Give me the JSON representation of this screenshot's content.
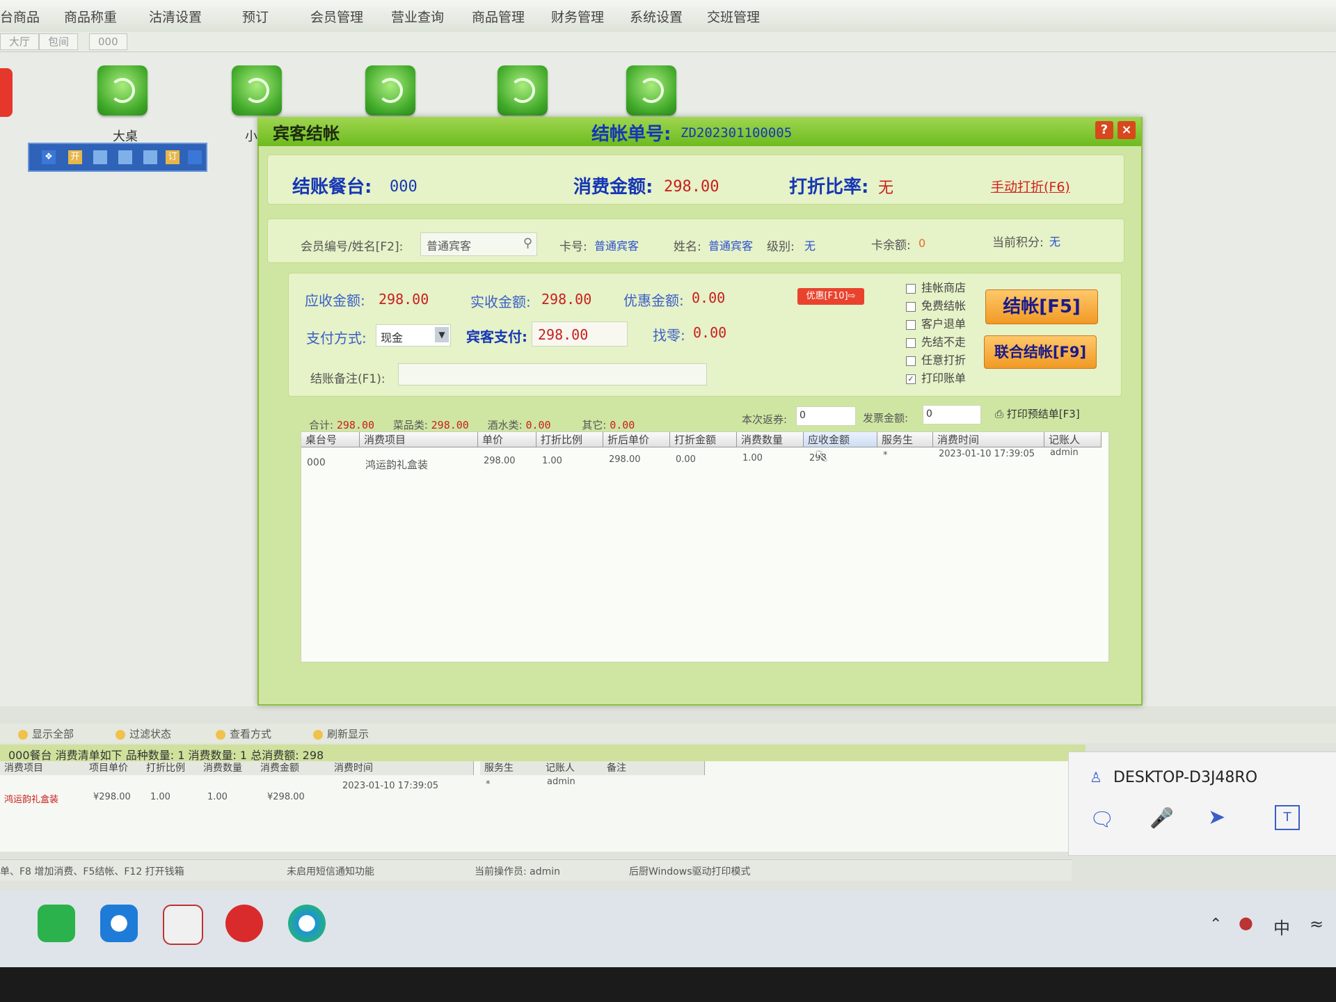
{
  "top_menu": {
    "items": [
      "台商品",
      "商品称重",
      "沽清设置",
      "预订",
      "会员管理",
      "营业查询",
      "商品管理",
      "财务管理",
      "系统设置",
      "交班管理"
    ]
  },
  "area_tabs": [
    "大厅",
    "包间",
    "000"
  ],
  "tables": [
    {
      "label": "大桌"
    },
    {
      "label": "小"
    }
  ],
  "status_buttons": [
    "❖",
    "开",
    "",
    "",
    "",
    "订",
    ""
  ],
  "dialog": {
    "title": "宾客结帐",
    "bill_no_label": "结帐单号:",
    "bill_no": "ZD202301100005",
    "help_icon": "?",
    "close_icon": "×",
    "info": {
      "table_label": "结账餐台:",
      "table_value": "000",
      "amount_label": "消费金额:",
      "amount_value": "298.00",
      "discount_label": "打折比率:",
      "discount_value": "无",
      "manual_discount": "手动打折(F6)"
    },
    "member": {
      "label": "会员编号/姓名[F2]:",
      "input_value": "普通宾客",
      "card_label": "卡号:",
      "card_value": "普通宾客",
      "name_label": "姓名:",
      "name_value": "普通宾客",
      "level_label": "级别:",
      "level_value": "无",
      "balance_label": "卡余额:",
      "balance_value": "0",
      "points_label": "当前积分:",
      "points_value": "无"
    },
    "payment": {
      "receivable_label": "应收金额:",
      "receivable_value": "298.00",
      "actual_label": "实收金额:",
      "actual_value": "298.00",
      "discount_amount_label": "优惠金额:",
      "discount_amount_value": "0.00",
      "coupon_button": "优惠[F10]⇨",
      "method_label": "支付方式:",
      "method_value": "现金",
      "guest_pay_label": "宾客支付:",
      "guest_pay_value": "298.00",
      "change_label": "找零:",
      "change_value": "0.00",
      "remark_label": "结账备注(F1):",
      "remark_value": ""
    },
    "options": [
      {
        "label": "挂帐商店",
        "checked": false
      },
      {
        "label": "免费结帐",
        "checked": false
      },
      {
        "label": "客户退单",
        "checked": false
      },
      {
        "label": "先结不走",
        "checked": false
      },
      {
        "label": "任意打折",
        "checked": false
      },
      {
        "label": "打印账单",
        "checked": true
      }
    ],
    "checkout_button": "结帐[F5]",
    "joint_checkout_button": "联合结帐[F9]",
    "totals": {
      "total_label": "合计:",
      "total_value": "298.00",
      "dishes_label": "菜品类:",
      "dishes_value": "298.00",
      "drinks_label": "酒水类:",
      "drinks_value": "0.00",
      "other_label": "其它:",
      "other_value": "0.00",
      "voucher_label": "本次返券:",
      "voucher_value": "0",
      "invoice_label": "发票金额:",
      "invoice_value": "0",
      "print_prebill": "打印预结单[F3]"
    },
    "grid": {
      "headers": [
        "桌台号",
        "消费项目",
        "单价",
        "打折比例",
        "折后单价",
        "打折金额",
        "消费数量",
        "应收金额",
        "服务生",
        "消费时间",
        "记账人"
      ],
      "rows": [
        [
          "000",
          "鸿运韵礼盒装",
          "298.00",
          "1.00",
          "298.00",
          "0.00",
          "1.00",
          "298",
          "*",
          "2023-01-10 17:39:05",
          "admin"
        ]
      ]
    }
  },
  "bottom_tools": [
    "显示全部",
    "过滤状态",
    "查看方式",
    "刷新显示"
  ],
  "summary_text": "000餐台  消费清单如下  品种数量: 1 消费数量: 1 总消费额: 298",
  "bottom_table": {
    "headers": [
      "消费项目",
      "项目单价",
      "打折比例",
      "消费数量",
      "消费金额",
      "消费时间",
      "服务生",
      "记账人",
      "备注"
    ],
    "row": [
      "鸿运韵礼盒装",
      "¥298.00",
      "1.00",
      "1.00",
      "¥298.00",
      "2023-01-10 17:39:05",
      "*",
      "admin",
      ""
    ]
  },
  "statusbar": {
    "shortcuts": "单、F8 增加消费、F5结帐、F12 打开钱箱",
    "sms": "未启用短信通知功能",
    "operator": "当前操作员: admin",
    "printer": "后厨Windows驱动打印模式"
  },
  "remote_panel": {
    "host": "DESKTOP-D3J48RO"
  },
  "tray": {
    "ime": "中"
  },
  "colors": {
    "title_green": "#6dbb1f",
    "label_blue": "#1536b5",
    "value_red": "#c81e1e",
    "button_orange": "#f09a24"
  }
}
